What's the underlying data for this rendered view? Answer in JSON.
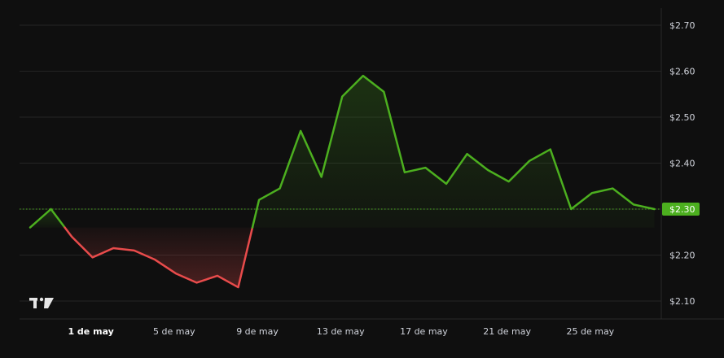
{
  "chart_data": {
    "type": "line",
    "x": [
      "28 abr",
      "29 abr",
      "30 abr",
      "1 de may",
      "2 may",
      "3 may",
      "4 may",
      "5 de may",
      "6 may",
      "7 may",
      "8 may",
      "9 de may",
      "10 may",
      "11 may",
      "12 may",
      "13 de may",
      "14 may",
      "15 may",
      "16 may",
      "17 de may",
      "18 may",
      "19 may",
      "20 may",
      "21 de may",
      "22 may",
      "23 may",
      "24 may",
      "25 de may",
      "26 may",
      "27 may",
      "28 may"
    ],
    "values": [
      2.26,
      2.3,
      2.24,
      2.195,
      2.215,
      2.21,
      2.19,
      2.16,
      2.14,
      2.155,
      2.13,
      2.32,
      2.345,
      2.47,
      2.37,
      2.545,
      2.59,
      2.555,
      2.38,
      2.39,
      2.355,
      2.42,
      2.385,
      2.36,
      2.405,
      2.43,
      2.3,
      2.335,
      2.345,
      2.31,
      2.3
    ],
    "baseline": 2.26,
    "current_price": 2.3,
    "current_price_label": "$2.30",
    "ylim": [
      2.08,
      2.72
    ],
    "y_ticks": [
      "$2.70",
      "$2.60",
      "$2.50",
      "$2.40",
      "$2.30",
      "$2.20",
      "$2.10"
    ],
    "y_tick_values": [
      2.7,
      2.6,
      2.5,
      2.4,
      2.3,
      2.2,
      2.1
    ],
    "x_tick_labels": [
      "1 de may",
      "5 de may",
      "9 de may",
      "13 de may",
      "17 de may",
      "21 de may",
      "25 de may"
    ],
    "x_tick_index": [
      3,
      7,
      11,
      15,
      19,
      23,
      27
    ],
    "x_tick_bold": [
      true,
      false,
      false,
      false,
      false,
      false,
      false
    ],
    "grid": true,
    "colors": {
      "up": "#4caf1f",
      "down": "#e84b4b",
      "background": "#0f0f0f",
      "grid": "#242424",
      "price_tag": "#4caf1f"
    },
    "logo": "TV"
  }
}
